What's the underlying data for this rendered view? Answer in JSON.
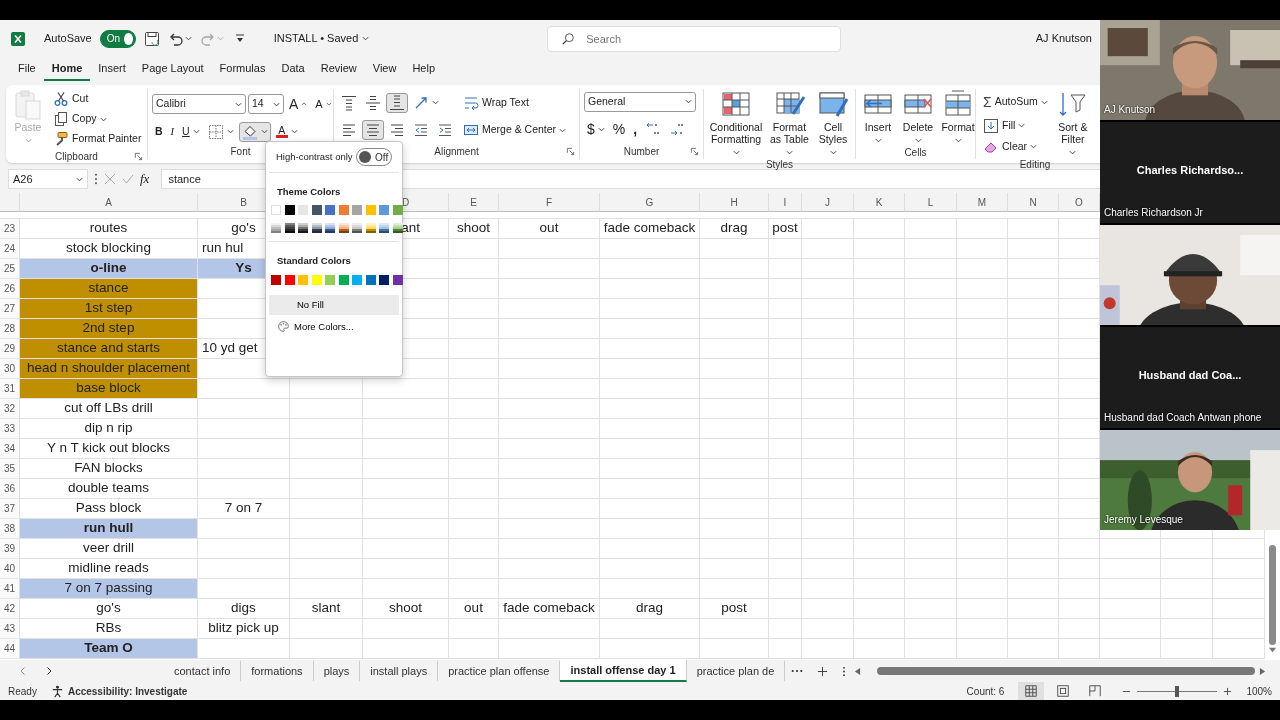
{
  "title_bar": {
    "autosave_label": "AutoSave",
    "autosave": {
      "on": true,
      "label": "On"
    },
    "quick_access": [
      {
        "kind": "save",
        "disabled": false
      },
      {
        "kind": "undo",
        "disabled": false
      },
      {
        "kind": "redo",
        "disabled": true
      },
      {
        "kind": "customize",
        "disabled": false
      }
    ],
    "document": "INSTALL • Saved",
    "search_placeholder": "Search",
    "user": "AJ Knutson"
  },
  "menu_tabs": [
    {
      "label": "File",
      "selected": false
    },
    {
      "label": "Home",
      "selected": true
    },
    {
      "label": "Insert",
      "selected": false
    },
    {
      "label": "Page Layout",
      "selected": false
    },
    {
      "label": "Formulas",
      "selected": false
    },
    {
      "label": "Data",
      "selected": false
    },
    {
      "label": "Review",
      "selected": false
    },
    {
      "label": "View",
      "selected": false
    },
    {
      "label": "Help",
      "selected": false
    }
  ],
  "ribbon": {
    "groups": [
      {
        "label": "Clipboard",
        "launcher": true,
        "columns": [
          {
            "kind": "paste",
            "label": "Paste",
            "disabled": true
          },
          {
            "kind": "stack",
            "lines": [
              {
                "items": [
                  {
                    "kind": "cut",
                    "label": "Cut"
                  }
                ]
              },
              {
                "items": [
                  {
                    "kind": "copy",
                    "label": "Copy"
                  }
                ]
              },
              {
                "items": [
                  {
                    "kind": "painter",
                    "label": "Format Painter"
                  }
                ]
              }
            ]
          }
        ]
      },
      {
        "label": "Font",
        "launcher": false,
        "columns": [
          {
            "kind": "stack",
            "lines": [
              {
                "items": [
                  {
                    "kind": "font-name",
                    "label": "Calibri"
                  },
                  {
                    "kind": "font-size",
                    "label": "14"
                  },
                  {
                    "kind": "grow",
                    "label": "A"
                  },
                  {
                    "kind": "shrink",
                    "label": "A"
                  }
                ]
              },
              {
                "items": [
                  {
                    "kind": "bold",
                    "label": "B",
                    "pressed": false
                  },
                  {
                    "kind": "italic",
                    "label": "I",
                    "pressed": false
                  },
                  {
                    "kind": "underline",
                    "label": "U",
                    "pressed": false
                  },
                  {
                    "kind": "borders",
                    "pressed": false
                  },
                  {
                    "kind": "fill",
                    "pressed": true
                  },
                  {
                    "kind": "fontcolor",
                    "label": "A",
                    "pressed": false
                  }
                ]
              }
            ]
          }
        ]
      },
      {
        "label": "Alignment",
        "launcher": true,
        "columns": [
          {
            "kind": "stack",
            "lines": [
              {
                "items": [
                  {
                    "kind": "align-top",
                    "pressed": false
                  },
                  {
                    "kind": "align-middle",
                    "pressed": false
                  },
                  {
                    "kind": "align-bottom",
                    "pressed": true
                  },
                  {
                    "kind": "orientation",
                    "pressed": false
                  }
                ]
              },
              {
                "items": [
                  {
                    "kind": "align-left",
                    "pressed": false
                  },
                  {
                    "kind": "align-center",
                    "pressed": true
                  },
                  {
                    "kind": "align-right",
                    "pressed": false
                  },
                  {
                    "kind": "indent-dec",
                    "pressed": false
                  },
                  {
                    "kind": "indent-inc",
                    "pressed": false
                  }
                ]
              }
            ]
          },
          {
            "kind": "stack",
            "lines": [
              {
                "items": [
                  {
                    "kind": "wrap",
                    "label": "Wrap Text"
                  }
                ]
              },
              {
                "items": [
                  {
                    "kind": "merge",
                    "label": "Merge & Center"
                  }
                ]
              }
            ]
          }
        ]
      },
      {
        "label": "Number",
        "launcher": true,
        "columns": [
          {
            "kind": "stack",
            "lines": [
              {
                "items": [
                  {
                    "kind": "number-format",
                    "label": "General"
                  }
                ]
              },
              {
                "items": [
                  {
                    "kind": "currency",
                    "label": "$"
                  },
                  {
                    "kind": "percent",
                    "label": "%"
                  },
                  {
                    "kind": "comma",
                    "label": ","
                  },
                  {
                    "kind": "inc-decimal"
                  },
                  {
                    "kind": "dec-decimal"
                  }
                ]
              }
            ]
          }
        ]
      },
      {
        "label": "Styles",
        "launcher": false,
        "columns": [
          {
            "kind": "cond",
            "label": "Conditional Formatting"
          },
          {
            "kind": "table",
            "label": "Format as Table"
          },
          {
            "kind": "cellstyles",
            "label": "Cell Styles"
          }
        ]
      },
      {
        "label": "Cells",
        "launcher": false,
        "columns": [
          {
            "kind": "insert",
            "label": "Insert"
          },
          {
            "kind": "delete",
            "label": "Delete"
          },
          {
            "kind": "format",
            "label": "Format"
          }
        ]
      },
      {
        "label": "Editing",
        "launcher": false,
        "columns": [
          {
            "kind": "stack",
            "lines": [
              {
                "items": [
                  {
                    "kind": "autosum",
                    "symbol": "Σ",
                    "label": "AutoSum"
                  }
                ]
              },
              {
                "items": [
                  {
                    "kind": "fillrow",
                    "label": "Fill"
                  }
                ]
              },
              {
                "items": [
                  {
                    "kind": "clear",
                    "label": "Clear"
                  }
                ]
              }
            ]
          },
          {
            "kind": "sort",
            "label": "Sort & Filter"
          }
        ]
      }
    ]
  },
  "formula_bar": {
    "name_box": "A26",
    "function_label": "fx",
    "formula": "stance"
  },
  "columns": [
    "A",
    "B",
    null,
    "D",
    "E",
    "F",
    "G",
    "H",
    "I",
    "J",
    "K",
    "L",
    "M",
    "N",
    "O"
  ],
  "rows": [
    {
      "number": "23",
      "cells": [
        {
          "text": "routes"
        },
        {
          "text": "go's"
        },
        null,
        {
          "text": "ant",
          "align_right": true
        },
        {
          "text": "shoot"
        },
        {
          "text": "out"
        },
        {
          "text": "fade comeback"
        },
        {
          "text": "drag"
        },
        {
          "text": "post"
        }
      ]
    },
    {
      "number": "24",
      "cells": [
        {
          "text": "stock blocking"
        },
        {
          "text": "run hul",
          "align_left": true
        }
      ]
    },
    {
      "number": "25",
      "cells": [
        {
          "text": "o-line",
          "bold": true,
          "color": "#b4c6e7"
        },
        {
          "text": "Ys",
          "bold": true,
          "color": "#b4c6e7"
        }
      ]
    },
    {
      "number": "26",
      "cells": [
        {
          "text": "stance",
          "color": "#bf8f00"
        }
      ]
    },
    {
      "number": "27",
      "cells": [
        {
          "text": "1st step",
          "color": "#bf8f00"
        }
      ]
    },
    {
      "number": "28",
      "cells": [
        {
          "text": "2nd step",
          "color": "#bf8f00"
        }
      ]
    },
    {
      "number": "29",
      "cells": [
        {
          "text": "stance and starts",
          "color": "#bf8f00"
        },
        {
          "text": "10 yd get",
          "align_left": true
        }
      ]
    },
    {
      "number": "30",
      "cells": [
        {
          "text": "head n shoulder placement",
          "color": "#bf8f00"
        }
      ]
    },
    {
      "number": "31",
      "cells": [
        {
          "text": "base block",
          "color": "#bf8f00"
        }
      ]
    },
    {
      "number": "32",
      "cells": [
        {
          "text": "cut off LBs drill"
        }
      ]
    },
    {
      "number": "33",
      "cells": [
        {
          "text": "dip n rip"
        }
      ]
    },
    {
      "number": "34",
      "cells": [
        {
          "text": "Y n T kick out blocks"
        }
      ]
    },
    {
      "number": "35",
      "cells": [
        {
          "text": "FAN blocks"
        }
      ]
    },
    {
      "number": "36",
      "cells": [
        {
          "text": "double teams"
        }
      ]
    },
    {
      "number": "37",
      "cells": [
        {
          "text": "Pass block"
        },
        {
          "text": "7 on 7"
        }
      ]
    },
    {
      "number": "38",
      "cells": [
        {
          "text": "run hull",
          "bold": true,
          "color": "#b4c6e7"
        }
      ]
    },
    {
      "number": "39",
      "cells": [
        {
          "text": "veer drill"
        }
      ]
    },
    {
      "number": "40",
      "cells": [
        {
          "text": "midline reads"
        }
      ]
    },
    {
      "number": "41",
      "cells": [
        {
          "text": "7 on 7 passing",
          "color": "#b4c6e7"
        }
      ]
    },
    {
      "number": "42",
      "cells": [
        {
          "text": "go's"
        },
        {
          "text": "digs"
        },
        {
          "text": "slant"
        },
        {
          "text": "shoot"
        },
        {
          "text": "out"
        },
        {
          "text": "fade comeback"
        },
        {
          "text": "drag"
        },
        {
          "text": "post"
        }
      ]
    },
    {
      "number": "43",
      "cells": [
        {
          "text": "RBs"
        },
        {
          "text": "blitz pick up"
        }
      ]
    },
    {
      "number": "44",
      "cells": [
        {
          "text": "Team O",
          "bold": true,
          "color": "#b4c6e7"
        }
      ]
    }
  ],
  "sheet_tabs": [
    {
      "label": "contact info",
      "selected": false
    },
    {
      "label": "formations",
      "selected": false
    },
    {
      "label": "plays",
      "selected": false
    },
    {
      "label": "install plays",
      "selected": false
    },
    {
      "label": "practice plan offense",
      "selected": false
    },
    {
      "label": "install offense day 1",
      "selected": true
    },
    {
      "label": "practice plan de",
      "selected": false
    }
  ],
  "status_bar": {
    "ready": "Ready",
    "accessibility": "Accessibility: Investigate",
    "count": "Count: 6",
    "views": [
      {
        "kind": "normal",
        "selected": true
      },
      {
        "kind": "page-layout",
        "selected": false
      },
      {
        "kind": "page-break",
        "selected": false
      }
    ],
    "zoom": {
      "level": 0.5,
      "label": "100%"
    }
  },
  "fill_color_menu": {
    "high_contrast_label": "High-contrast only",
    "high_contrast": {
      "on": false,
      "label": "Off"
    },
    "theme_heading": "Theme Colors",
    "theme_colors": [
      {
        "color": "#ffffff"
      },
      {
        "color": "#000000"
      },
      {
        "color": "#e7e6e6"
      },
      {
        "color": "#44546a"
      },
      {
        "color": "#4472c4"
      },
      {
        "color": "#ed7d31"
      },
      {
        "color": "#a5a5a5"
      },
      {
        "color": "#ffc000"
      },
      {
        "color": "#5b9bd5"
      },
      {
        "color": "#70ad47"
      }
    ],
    "standard_heading": "Standard Colors",
    "standard_colors": [
      {
        "color": "#c00000"
      },
      {
        "color": "#ff0000"
      },
      {
        "color": "#ffc000"
      },
      {
        "color": "#ffff00"
      },
      {
        "color": "#92d050"
      },
      {
        "color": "#00b050"
      },
      {
        "color": "#00b0f0"
      },
      {
        "color": "#0070c0"
      },
      {
        "color": "#002060"
      },
      {
        "color": "#7030a0"
      }
    ],
    "no_fill": "No Fill",
    "more_colors": "More Colors..."
  },
  "participants": [
    {
      "kind": "video",
      "name": "AJ Knutson"
    },
    {
      "kind": "name-card",
      "display_name": "Charles Richardso...",
      "name": "Charles Richardson Jr"
    },
    {
      "kind": "video"
    },
    {
      "kind": "name-card",
      "display_name": "Husband dad Coa...",
      "name": "Husband dad Coach Antwan phone"
    },
    {
      "kind": "video",
      "name": "Jeremy Levesque"
    }
  ]
}
